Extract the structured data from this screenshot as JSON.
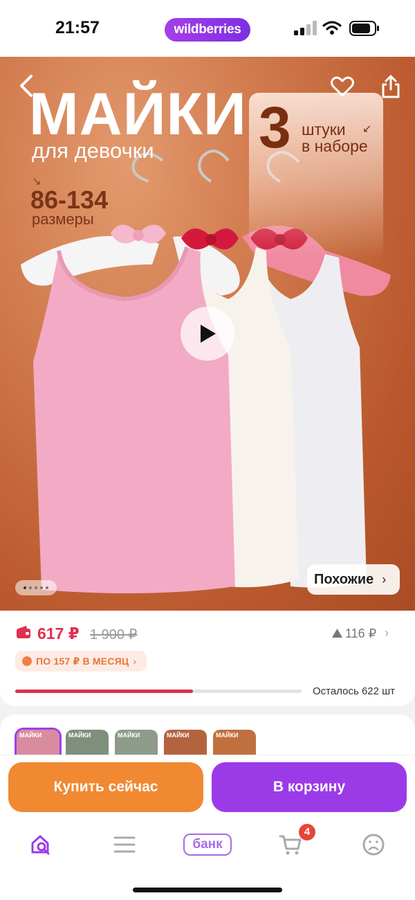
{
  "status_bar": {
    "time": "21:57",
    "brand": "wildberries"
  },
  "hero": {
    "title": "МАЙКИ",
    "subtitle": "для девочки",
    "sizes_range": "86-134",
    "sizes_label": "размеры",
    "badge_number": "3",
    "badge_line1": "штуки",
    "badge_line2": "в наборе",
    "similar_label": "Похожие",
    "slide_count": 5,
    "active_slide": 0
  },
  "price": {
    "current": "617 ₽",
    "old": "1 900 ₽",
    "delta": "116 ₽",
    "installment": "ПО 157 ₽ В МЕСЯЦ",
    "stock_text": "Осталось 622 шт",
    "stock_fraction": 0.62
  },
  "variants": [
    {
      "label": "МАЙКИ",
      "color": "#d98ba0"
    },
    {
      "label": "МАЙКИ",
      "color": "#7f8f7c"
    },
    {
      "label": "МАЙКИ",
      "color": "#8e9a8a"
    },
    {
      "label": "МАЙКИ",
      "color": "#b3643f"
    },
    {
      "label": "МАЙКИ",
      "color": "#c0703f"
    }
  ],
  "actions": {
    "buy_now": "Купить сейчас",
    "add_to_cart": "В корзину"
  },
  "tabbar": {
    "bank_label": "банк",
    "cart_count": "4"
  },
  "colors": {
    "accent": "#9b3be8",
    "orange": "#f08932",
    "price_red": "#e0304e"
  }
}
